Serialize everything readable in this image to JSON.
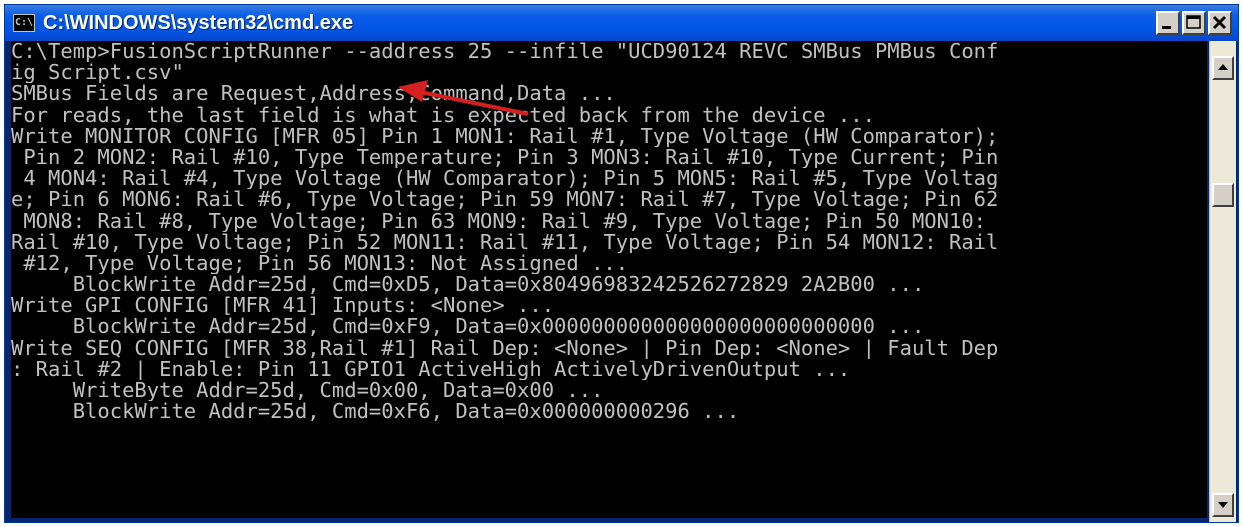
{
  "window": {
    "title": "C:\\WINDOWS\\system32\\cmd.exe",
    "icon_name": "console-icon",
    "icon_text": "C:\\"
  },
  "controls": {
    "minimize_icon": "minimize-icon",
    "maximize_icon": "maximize-icon",
    "close_icon": "close-icon"
  },
  "console": {
    "lines": [
      "C:\\Temp>FusionScriptRunner --address 25 --infile \"UCD90124 REVC SMBus PMBus Conf",
      "ig Script.csv\"",
      "SMBus Fields are Request,Address,Command,Data ...",
      "For reads, the last field is what is expected back from the device ...",
      "Write MONITOR_CONFIG [MFR 05] Pin 1 MON1: Rail #1, Type Voltage (HW Comparator);",
      " Pin 2 MON2: Rail #10, Type Temperature; Pin 3 MON3: Rail #10, Type Current; Pin",
      " 4 MON4: Rail #4, Type Voltage (HW Comparator); Pin 5 MON5: Rail #5, Type Voltag",
      "e; Pin 6 MON6: Rail #6, Type Voltage; Pin 59 MON7: Rail #7, Type Voltage; Pin 62",
      " MON8: Rail #8, Type Voltage; Pin 63 MON9: Rail #9, Type Voltage; Pin 50 MON10:",
      "Rail #10, Type Voltage; Pin 52 MON11: Rail #11, Type Voltage; Pin 54 MON12: Rail",
      " #12, Type Voltage; Pin 56 MON13: Not Assigned ...",
      "     BlockWrite Addr=25d, Cmd=0xD5, Data=0x80496983242526272829 2A2B00 ...",
      "Write GPI_CONFIG [MFR 41] Inputs: <None> ...",
      "     BlockWrite Addr=25d, Cmd=0xF9, Data=0x000000000000000000000000000 ...",
      "Write SEQ_CONFIG [MFR 38,Rail #1] Rail Dep: <None> | Pin Dep: <None> | Fault Dep",
      ": Rail #2 | Enable: Pin 11 GPIO1 ActiveHigh ActivelyDrivenOutput ...",
      "     WriteByte Addr=25d, Cmd=0x00, Data=0x00 ...",
      "     BlockWrite Addr=25d, Cmd=0xF6, Data=0x000000000296 ..."
    ]
  },
  "annotation": {
    "arrow_color": "#d42020",
    "arrow_icon": "red-arrow-annotation"
  },
  "colors": {
    "console_bg": "#000000",
    "console_fg": "#c0c0c0",
    "titlebar": "#0055e5"
  }
}
